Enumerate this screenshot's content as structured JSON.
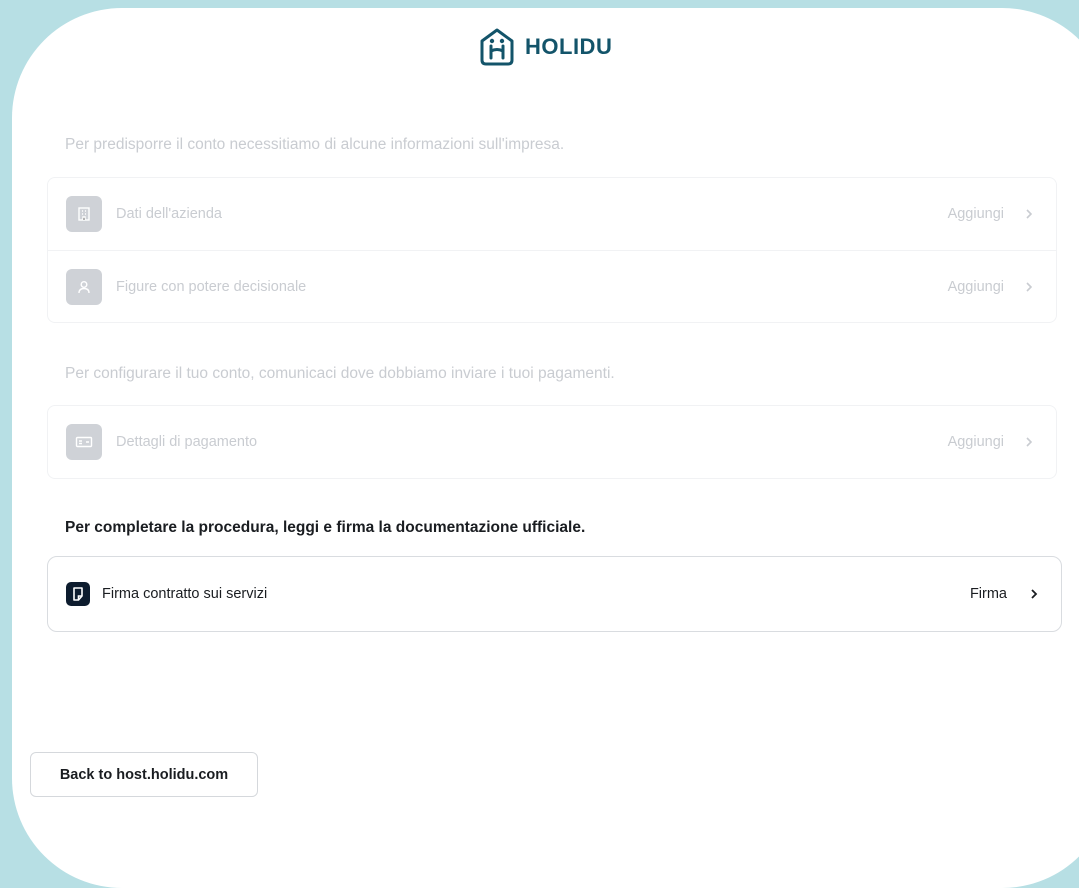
{
  "brand": {
    "name": "HOLIDU",
    "color": "#13546a"
  },
  "sections": [
    {
      "intro": "Per predisporre il conto necessitiamo di alcune informazioni sull'impresa.",
      "items": [
        {
          "label": "Dati dell'azienda",
          "action": "Aggiungi",
          "icon": "building-icon"
        },
        {
          "label": "Figure con potere decisionale",
          "action": "Aggiungi",
          "icon": "person-icon"
        }
      ]
    },
    {
      "intro": "Per configurare il tuo conto, comunicaci dove dobbiamo inviare i tuoi pagamenti.",
      "items": [
        {
          "label": "Dettagli di pagamento",
          "action": "Aggiungi",
          "icon": "payment-card-icon"
        }
      ]
    },
    {
      "intro": "Per completare la procedura, leggi e firma la documentazione ufficiale.",
      "items": [
        {
          "label": "Firma contratto sui servizi",
          "action": "Firma",
          "icon": "document-sign-icon"
        }
      ]
    }
  ],
  "footer": {
    "back_label": "Back to host.holidu.com"
  },
  "colors": {
    "background": "#b7dfe4",
    "disabled_text": "#c9ccd1",
    "active_text": "#1a1d21",
    "active_icon_bg": "#0d1c2e"
  }
}
